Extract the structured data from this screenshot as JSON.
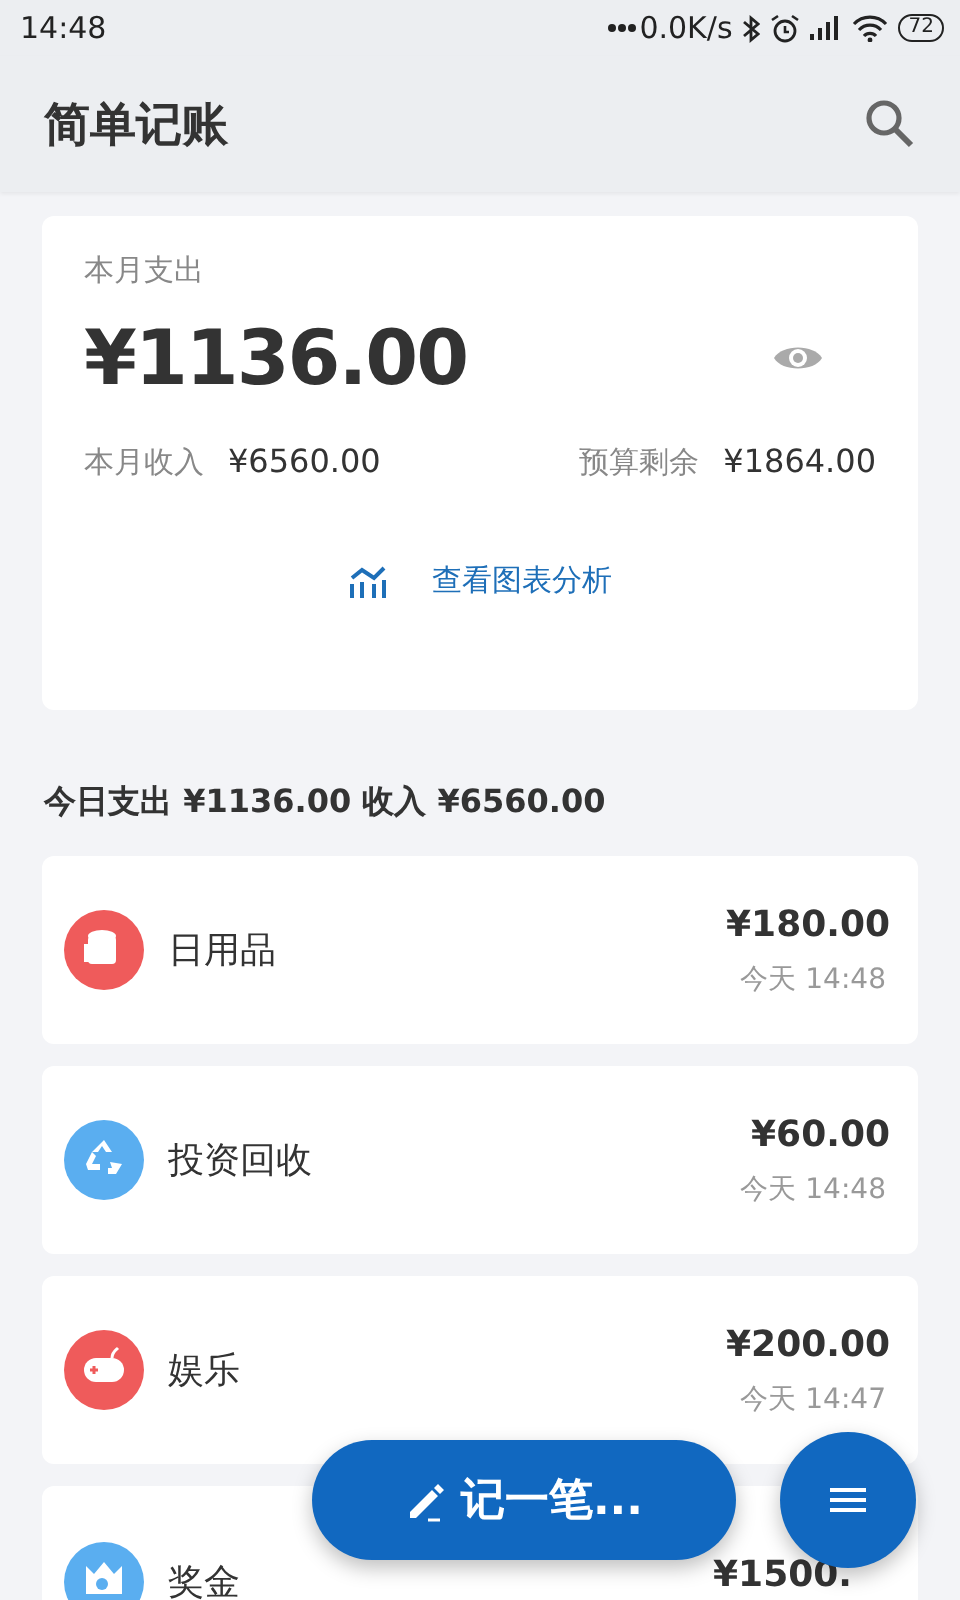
{
  "status_bar": {
    "time": "14:48",
    "net_speed": "0.0K/s",
    "battery": "72"
  },
  "app_bar": {
    "title": "简单记账"
  },
  "summary": {
    "label": "本月支出",
    "amount": "¥1136.00",
    "income_label": "本月收入",
    "income": "¥6560.00",
    "budget_label": "预算剩余",
    "budget": "¥1864.00",
    "chart_link": "查看图表分析"
  },
  "day_header": "今日支出 ¥1136.00 收入 ¥6560.00",
  "records": [
    {
      "name": "日用品",
      "amount": "¥180.00",
      "time": "今天 14:48",
      "color": "#ef5b5b"
    },
    {
      "name": "投资回收",
      "amount": "¥60.00",
      "time": "今天 14:48",
      "color": "#5aaef0"
    },
    {
      "name": "娱乐",
      "amount": "¥200.00",
      "time": "今天 14:47",
      "color": "#ef5b5b"
    },
    {
      "name": "奖金",
      "amount": "¥1500.",
      "color": "#5aaef0"
    }
  ],
  "fab": {
    "label": "记一笔..."
  }
}
